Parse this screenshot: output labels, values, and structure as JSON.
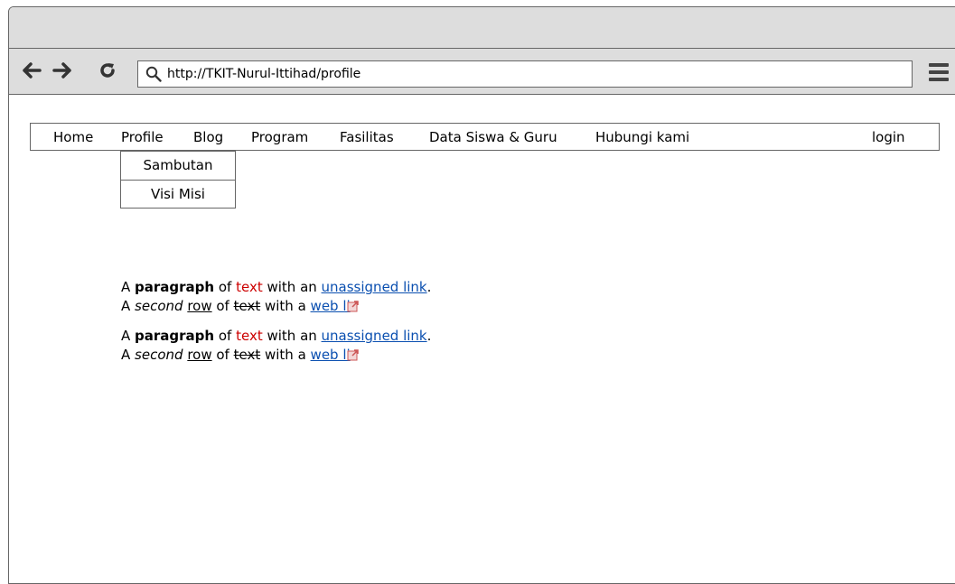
{
  "browser": {
    "url": "http://TKIT-Nurul-Ittihad/profile",
    "back_icon": "arrow-left-icon",
    "forward_icon": "arrow-right-icon",
    "reload_icon": "reload-icon",
    "menu_icon": "hamburger-icon"
  },
  "nav": {
    "items": [
      {
        "label": "Home"
      },
      {
        "label": "Profile"
      },
      {
        "label": "Blog"
      },
      {
        "label": "Program"
      },
      {
        "label": "Fasilitas"
      },
      {
        "label": "Data Siswa & Guru"
      },
      {
        "label": "Hubungi kami"
      }
    ],
    "login": "login"
  },
  "dropdown": {
    "items": [
      {
        "label": "Sambutan"
      },
      {
        "label": "Visi Misi"
      }
    ]
  },
  "paragraphs": [
    {
      "line1": {
        "a": "A ",
        "bold": "paragraph",
        "of": " of ",
        "red": "text",
        "with": " with an ",
        "link": "unassigned link",
        "end": "."
      },
      "line2": {
        "a": "A ",
        "italic": "second",
        "sp": " ",
        "under": "row",
        "of": " of ",
        "strike": "text",
        "with": " with a ",
        "link": "web li"
      }
    },
    {
      "line1": {
        "a": "A ",
        "bold": "paragraph",
        "of": " of ",
        "red": "text",
        "with": " with an ",
        "link": "unassigned link",
        "end": "."
      },
      "line2": {
        "a": "A ",
        "italic": "second",
        "sp": " ",
        "under": "row",
        "of": " of ",
        "strike": "text",
        "with": " with a ",
        "link": "web li"
      }
    }
  ],
  "colors": {
    "chrome": "#dddddd",
    "link": "#0a4fb0",
    "red_text": "#cc0000"
  }
}
